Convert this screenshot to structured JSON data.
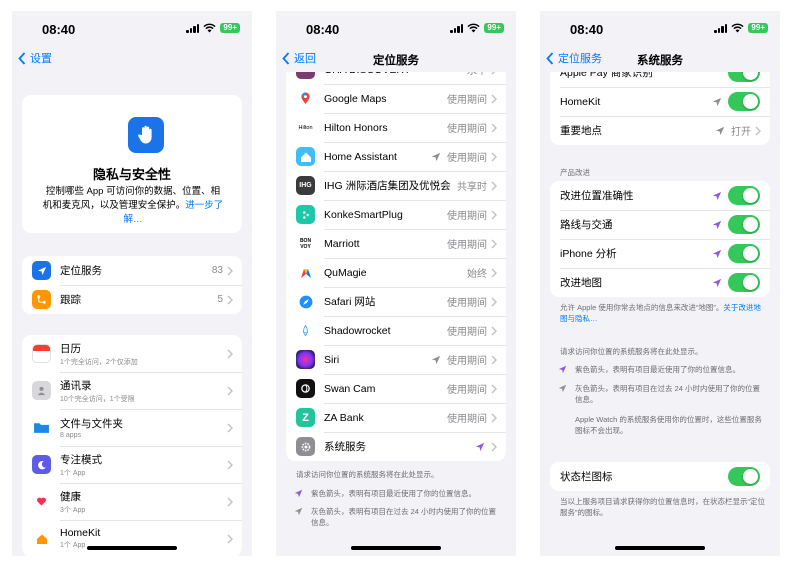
{
  "status": {
    "time": "08:40",
    "time2": "08:40",
    "time3": "08:40",
    "battery": "99+"
  },
  "colors": {
    "accent": "#007aff",
    "toggle_on": "#34c759",
    "purple_arrow": "#8e5bd9"
  },
  "screen1": {
    "back": "设置",
    "hero_title": "隐私与安全性",
    "hero_desc": "控制哪些 App 可访问你的数据、位置、相机和麦克风，以及管理安全保护。",
    "hero_link": "进一步了解…",
    "items1": [
      {
        "label": "定位服务",
        "value": "83"
      },
      {
        "label": "跟踪",
        "value": "5"
      }
    ],
    "items2": [
      {
        "label": "日历",
        "sub": "1个完全访问，2个仅添加"
      },
      {
        "label": "通讯录",
        "sub": "10个完全访问，1个受限"
      },
      {
        "label": "文件与文件夹",
        "sub": "8 apps"
      },
      {
        "label": "专注模式",
        "sub": "1个 App"
      },
      {
        "label": "健康",
        "sub": "3个 App"
      },
      {
        "label": "HomeKit",
        "sub": "1个 App"
      }
    ]
  },
  "screen2": {
    "back": "返回",
    "title": "定位服务",
    "apps": [
      {
        "label": "GHA DISCOVERY",
        "value": "永不",
        "icon": "gha-icon",
        "arrow": false
      },
      {
        "label": "Google Maps",
        "value": "使用期间",
        "icon": "google-maps-icon",
        "arrow": false
      },
      {
        "label": "Hilton Honors",
        "value": "使用期间",
        "icon": "hilton-icon",
        "icontext": "Hilton",
        "arrow": false
      },
      {
        "label": "Home Assistant",
        "value": "使用期间",
        "icon": "home-assistant-icon",
        "arrow": true
      },
      {
        "label": "IHG 洲际酒店集团及优悦会",
        "value": "共享时",
        "icon": "ihg-icon",
        "icontext": "IHG",
        "arrow": false
      },
      {
        "label": "KonkeSmartPlug",
        "value": "使用期间",
        "icon": "konke-icon",
        "arrow": false
      },
      {
        "label": "Marriott",
        "value": "使用期间",
        "icon": "marriott-icon",
        "icontext": "BON\nVOY",
        "arrow": false
      },
      {
        "label": "QuMagie",
        "value": "始终",
        "icon": "qumagie-icon",
        "arrow": false
      },
      {
        "label": "Safari 网站",
        "value": "使用期间",
        "icon": "safari-icon",
        "arrow": false
      },
      {
        "label": "Shadowrocket",
        "value": "使用期间",
        "icon": "shadowrocket-icon",
        "arrow": false
      },
      {
        "label": "Siri",
        "value": "使用期间",
        "icon": "siri-icon",
        "arrow": true
      },
      {
        "label": "Swan Cam",
        "value": "使用期间",
        "icon": "swan-cam-icon",
        "arrow": false
      },
      {
        "label": "ZA Bank",
        "value": "使用期间",
        "icon": "za-bank-icon",
        "icontext": "Z",
        "arrow": false
      },
      {
        "label": "系统服务",
        "value": "",
        "icon": "gear-icon",
        "arrow": true,
        "purple": true
      }
    ],
    "footer": "请求访问你位置的系统服务将在此处显示。",
    "legend_purple": "紫色箭头，表明有项目最近使用了你的位置信息。",
    "legend_gray": "灰色箭头，表明有项目在过去 24 小时内使用了你的位置信息。"
  },
  "screen3": {
    "back": "定位服务",
    "title": "系统服务",
    "top_rows": [
      {
        "label": "Apple Pay 商家识别",
        "arrow": false,
        "toggle": true
      },
      {
        "label": "HomeKit",
        "arrow": "gray",
        "toggle": true
      },
      {
        "label": "重要地点",
        "arrow": "gray",
        "value": "打开"
      }
    ],
    "section_header": "产品改进",
    "improve_rows": [
      {
        "label": "改进位置准确性"
      },
      {
        "label": "路线与交通"
      },
      {
        "label": "iPhone 分析"
      },
      {
        "label": "改进地图"
      }
    ],
    "improve_footer": "允许 Apple 使用你常去地点的信息来改进“地图”。",
    "improve_link": "关于改进地图与隐私…",
    "info_title": "请求访问你位置的系统服务将在此处显示。",
    "legend_purple": "紫色箭头，表明有项目最近使用了你的位置信息。",
    "legend_gray": "灰色箭头，表明有项目在过去 24 小时内使用了你的位置信息。",
    "watch_note": "Apple Watch 的系统服务使用你的位置时，这些位置服务图标不会出现。",
    "status_bar_label": "状态栏图标",
    "status_bar_footer": "当以上服务项目请求获得你的位置信息时，在状态栏显示“定位服务”的图标。"
  }
}
